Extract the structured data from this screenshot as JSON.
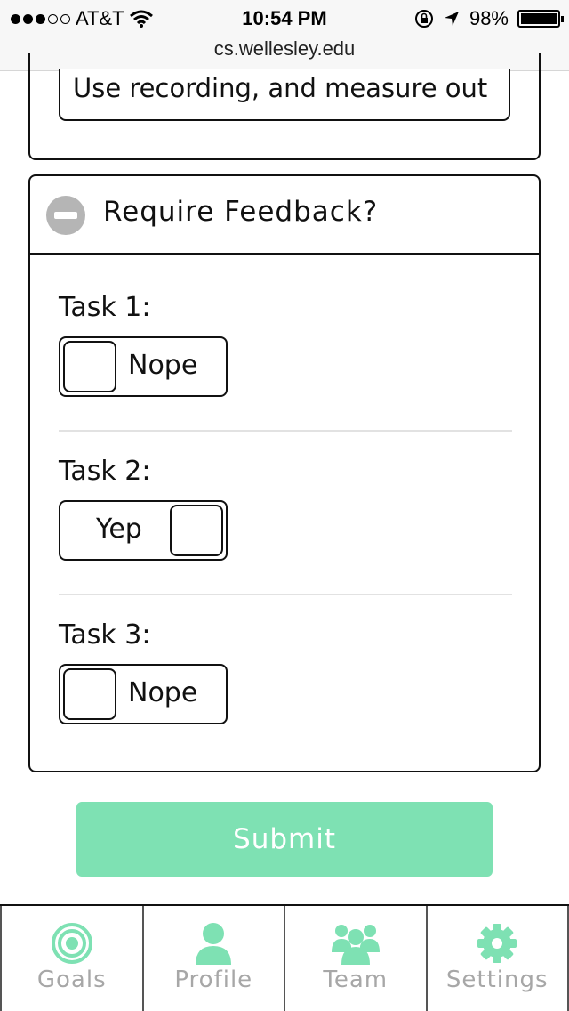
{
  "status_bar": {
    "carrier": "AT&T",
    "time": "10:54 PM",
    "battery": "98%",
    "signal_dots_filled": 3,
    "signal_dots_total": 5
  },
  "browser": {
    "url": "cs.wellesley.edu"
  },
  "previous_field": {
    "value": "Use recording, and measure out"
  },
  "feedback_section": {
    "title": "Require Feedback?",
    "tasks": [
      {
        "label": "Task 1:",
        "toggle": "Nope",
        "state": "off"
      },
      {
        "label": "Task 2:",
        "toggle": "Yep",
        "state": "on"
      },
      {
        "label": "Task 3:",
        "toggle": "Nope",
        "state": "off"
      }
    ]
  },
  "submit_label": "Submit",
  "tabs": [
    {
      "label": "Goals",
      "icon": "target-icon"
    },
    {
      "label": "Profile",
      "icon": "person-icon"
    },
    {
      "label": "Team",
      "icon": "group-icon"
    },
    {
      "label": "Settings",
      "icon": "gear-icon"
    }
  ],
  "colors": {
    "accent": "#7ee1b3",
    "tab_icon": "#7ee1b3",
    "tab_label": "#a7a7a7"
  }
}
